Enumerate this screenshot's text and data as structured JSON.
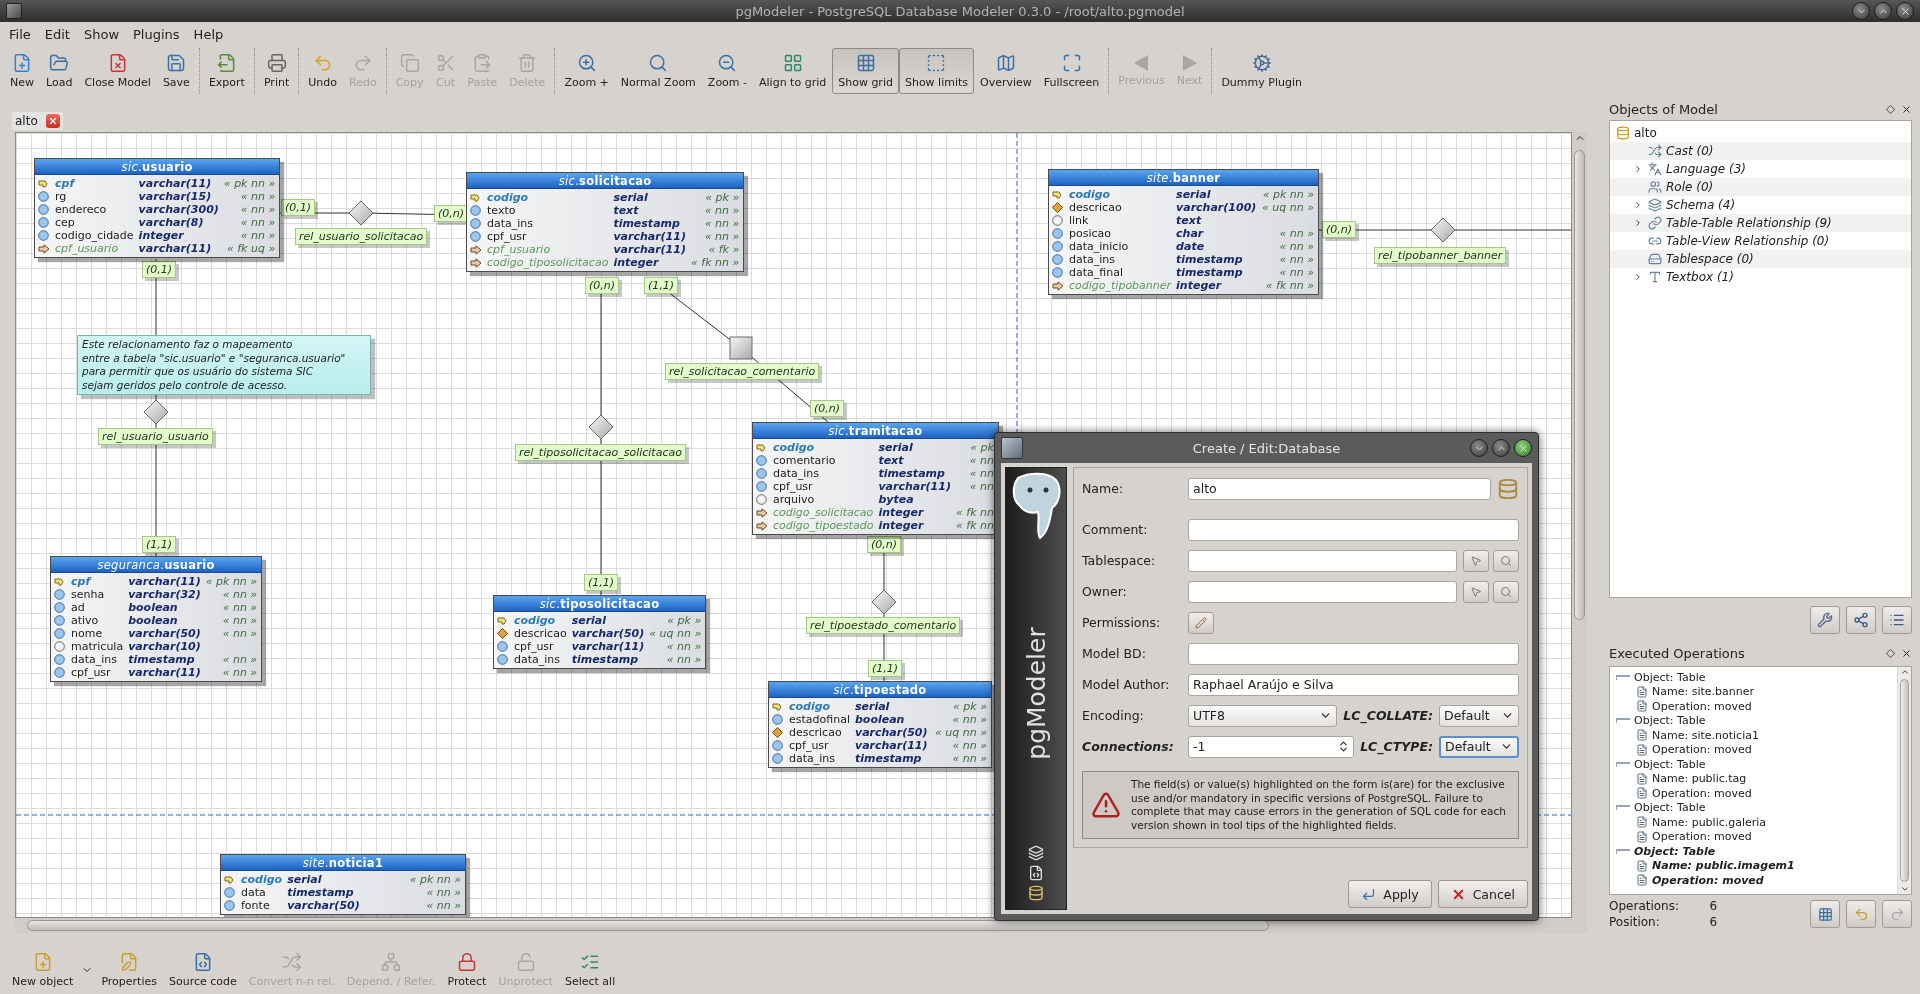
{
  "window": {
    "title": "pgModeler - PostgreSQL Database Modeler 0.3.0 - /root/alto.pgmodel"
  },
  "menu": [
    "File",
    "Edit",
    "Show",
    "Plugins",
    "Help"
  ],
  "toolbar": {
    "groups": [
      {
        "buttons": [
          {
            "label": "New",
            "disabled": false
          },
          {
            "label": "Load",
            "disabled": false
          },
          {
            "label": "Close Model",
            "disabled": false
          },
          {
            "label": "Save",
            "disabled": false
          }
        ]
      },
      {
        "buttons": [
          {
            "label": "Export",
            "disabled": false
          }
        ]
      },
      {
        "buttons": [
          {
            "label": "Print",
            "disabled": false
          }
        ]
      },
      {
        "buttons": [
          {
            "label": "Undo",
            "disabled": false
          },
          {
            "label": "Redo",
            "disabled": true
          }
        ]
      },
      {
        "buttons": [
          {
            "label": "Copy",
            "disabled": true
          },
          {
            "label": "Cut",
            "disabled": true
          },
          {
            "label": "Paste",
            "disabled": true
          },
          {
            "label": "Delete",
            "disabled": true
          }
        ]
      },
      {
        "buttons": [
          {
            "label": "Zoom +",
            "disabled": false
          },
          {
            "label": "Normal Zoom",
            "disabled": false
          },
          {
            "label": "Zoom -",
            "disabled": false
          },
          {
            "label": "Align to grid",
            "disabled": false
          },
          {
            "label": "Show grid",
            "disabled": false,
            "checked": true
          },
          {
            "label": "Show limits",
            "disabled": false,
            "checked": true
          },
          {
            "label": "Overview",
            "disabled": false
          },
          {
            "label": "Fullscreen",
            "disabled": false
          }
        ]
      },
      {
        "buttons": [
          {
            "label": "Previous",
            "disabled": true
          },
          {
            "label": "Next",
            "disabled": true
          }
        ]
      },
      {
        "buttons": [
          {
            "label": "Dummy Plugin",
            "disabled": false
          }
        ]
      }
    ]
  },
  "tabs": [
    {
      "label": "alto",
      "selected": true
    }
  ],
  "diagram": {
    "tables": [
      {
        "title": "*sic*.**usuario**",
        "columns": [
          {
            "name": "cpf",
            "type": "varchar(11)",
            "constraint": "« pk nn »",
            "kind": "pk"
          },
          {
            "name": "rg",
            "type": "varchar(15)",
            "constraint": "« nn »",
            "kind": "nn"
          },
          {
            "name": "endereco",
            "type": "varchar(300)",
            "constraint": "« nn »",
            "kind": "nn"
          },
          {
            "name": "cep",
            "type": "varchar(8)",
            "constraint": "« nn »",
            "kind": "nn"
          },
          {
            "name": "codigo_cidade",
            "type": "integer",
            "constraint": "« nn »",
            "kind": "nn"
          },
          {
            "name": "cpf_usuario",
            "type": "varchar(11)",
            "constraint": "« fk uq »",
            "kind": "fk"
          }
        ]
      },
      {
        "title": "*sic*.**solicitacao**",
        "columns": [
          {
            "name": "codigo",
            "type": "serial",
            "constraint": "« pk »",
            "kind": "pk"
          },
          {
            "name": "texto",
            "type": "text",
            "constraint": "« nn »",
            "kind": "nn"
          },
          {
            "name": "data_ins",
            "type": "timestamp",
            "constraint": "« nn »",
            "kind": "nn"
          },
          {
            "name": "cpf_usr",
            "type": "varchar(11)",
            "constraint": "« nn »",
            "kind": "nn"
          },
          {
            "name": "cpf_usuario",
            "type": "varchar(11)",
            "constraint": "« fk »",
            "kind": "fk"
          },
          {
            "name": "codigo_tiposolicitacao",
            "type": "integer",
            "constraint": "« fk nn »",
            "kind": "fk"
          }
        ]
      },
      {
        "title": "*site*.**banner**",
        "columns": [
          {
            "name": "codigo",
            "type": "serial",
            "constraint": "« pk nn »",
            "kind": "pk"
          },
          {
            "name": "descricao",
            "type": "varchar(100)",
            "constraint": "« uq nn »",
            "kind": "uq"
          },
          {
            "name": "link",
            "type": "text",
            "kind": "plain"
          },
          {
            "name": "posicao",
            "type": "char",
            "constraint": "« nn »",
            "kind": "nn"
          },
          {
            "name": "data_inicio",
            "type": "date",
            "constraint": "« nn »",
            "kind": "nn"
          },
          {
            "name": "data_ins",
            "type": "timestamp",
            "constraint": "« nn »",
            "kind": "nn"
          },
          {
            "name": "data_final",
            "type": "timestamp",
            "constraint": "« nn »",
            "kind": "nn"
          },
          {
            "name": "codigo_tipobanner",
            "type": "integer",
            "constraint": "« fk nn »",
            "kind": "fk"
          }
        ]
      },
      {
        "title": "*sic*.**tramitacao**",
        "columns": [
          {
            "name": "codigo",
            "type": "serial",
            "constraint": "« pk",
            "kind": "pk"
          },
          {
            "name": "comentario",
            "type": "text",
            "constraint": "« nn",
            "kind": "nn"
          },
          {
            "name": "data_ins",
            "type": "timestamp",
            "constraint": "« nn",
            "kind": "nn"
          },
          {
            "name": "cpf_usr",
            "type": "varchar(11)",
            "constraint": "« nn",
            "kind": "nn"
          },
          {
            "name": "arquivo",
            "type": "bytea",
            "kind": "plain"
          },
          {
            "name": "codigo_solicitacao",
            "type": "integer",
            "constraint": "« fk nn",
            "kind": "fk"
          },
          {
            "name": "codigo_tipoestado",
            "type": "integer",
            "constraint": "« fk nn",
            "kind": "fk"
          }
        ]
      },
      {
        "title": "*seguranca*.**usuario**",
        "columns": [
          {
            "name": "cpf",
            "type": "varchar(11)",
            "constraint": "« pk nn »",
            "kind": "pk"
          },
          {
            "name": "senha",
            "type": "varchar(32)",
            "constraint": "« nn »",
            "kind": "nn"
          },
          {
            "name": "ad",
            "type": "boolean",
            "constraint": "« nn »",
            "kind": "nn"
          },
          {
            "name": "ativo",
            "type": "boolean",
            "constraint": "« nn »",
            "kind": "nn"
          },
          {
            "name": "nome",
            "type": "varchar(50)",
            "constraint": "« nn »",
            "kind": "nn"
          },
          {
            "name": "matricula",
            "type": "varchar(10)",
            "kind": "plain"
          },
          {
            "name": "data_ins",
            "type": "timestamp",
            "constraint": "« nn »",
            "kind": "nn"
          },
          {
            "name": "cpf_usr",
            "type": "varchar(11)",
            "constraint": "« nn »",
            "kind": "nn"
          }
        ]
      },
      {
        "title": "*sic*.**tiposolicitacao**",
        "columns": [
          {
            "name": "codigo",
            "type": "serial",
            "constraint": "« pk »",
            "kind": "pk"
          },
          {
            "name": "descricao",
            "type": "varchar(50)",
            "constraint": "« uq nn »",
            "kind": "uq"
          },
          {
            "name": "cpf_usr",
            "type": "varchar(11)",
            "constraint": "« nn »",
            "kind": "nn"
          },
          {
            "name": "data_ins",
            "type": "timestamp",
            "constraint": "« nn »",
            "kind": "nn"
          }
        ]
      },
      {
        "title": "*sic*.**tipoestado**",
        "columns": [
          {
            "name": "codigo",
            "type": "serial",
            "constraint": "« pk »",
            "kind": "pk"
          },
          {
            "name": "estadofinal",
            "type": "boolean",
            "constraint": "« nn »",
            "kind": "nn"
          },
          {
            "name": "descricao",
            "type": "varchar(50)",
            "constraint": "« uq nn »",
            "kind": "uq"
          },
          {
            "name": "cpf_usr",
            "type": "varchar(11)",
            "constraint": "« nn »",
            "kind": "nn"
          },
          {
            "name": "data_ins",
            "type": "timestamp",
            "constraint": "« nn »",
            "kind": "nn"
          }
        ]
      },
      {
        "title": "*site*.**noticia1**",
        "columns": [
          {
            "name": "codigo",
            "type": "serial",
            "constraint": "« pk nn »",
            "kind": "pk"
          },
          {
            "name": "data",
            "type": "timestamp",
            "constraint": "« nn »",
            "kind": "nn"
          },
          {
            "name": "fonte",
            "type": "varchar(50)",
            "constraint": "« nn »",
            "kind": "nn"
          }
        ]
      }
    ],
    "relationships": [
      {
        "label": "rel_usuario_solicitacao",
        "kind": "diamond",
        "cardinalities": [
          "(0,1)",
          "(0,n)"
        ]
      },
      {
        "label": "rel_usuario_usuario",
        "kind": "diamond",
        "cardinalities": [
          "(0,1)",
          "(1,1)"
        ]
      },
      {
        "label": "rel_tiposolicitacao_solicitacao",
        "kind": "diamond",
        "cardinalities": [
          "(0,n)",
          "(1,1)"
        ]
      },
      {
        "label": "rel_solicitacao_comentario",
        "kind": "square",
        "cardinalities": [
          "(1,1)",
          "(0,n)"
        ]
      },
      {
        "label": "rel_tipoestado_comentario",
        "kind": "diamond",
        "cardinalities": [
          "(0,n)",
          "(1,1)"
        ]
      },
      {
        "label": "rel_tipobanner_banner",
        "kind": "diamond",
        "cardinalities": [
          "(0,n)"
        ]
      }
    ],
    "note": "Este relacionamento faz o mapeamento\nentre a tabela \"sic.usuario\" e \"seguranca.usuario\"\npara permitir que os usuário do sistema SIC\nsejam geridos pelo controle de acesso."
  },
  "objects_panel": {
    "title": "Objects of Model",
    "tree": [
      {
        "label": "alto",
        "children": [
          {
            "label": "Cast (0)"
          },
          {
            "label": "Language (3)",
            "expanded": false
          },
          {
            "label": "Role (0)"
          },
          {
            "label": "Schema (4)",
            "expanded": false
          },
          {
            "label": "Table-Table Relationship (9)",
            "expanded": false
          },
          {
            "label": "Table-View Relationship (0)"
          },
          {
            "label": "Tablespace (0)"
          },
          {
            "label": "Textbox (1)",
            "expanded": false
          }
        ]
      }
    ]
  },
  "operations_panel": {
    "title": "Executed Operations",
    "operations": [
      {
        "label": "Object: Table",
        "current": false,
        "children": [
          {
            "label": "Name: site.banner"
          },
          {
            "label": "Operation: moved"
          }
        ]
      },
      {
        "label": "Object: Table",
        "current": false,
        "children": [
          {
            "label": "Name: site.noticia1"
          },
          {
            "label": "Operation: moved"
          }
        ]
      },
      {
        "label": "Object: Table",
        "current": false,
        "children": [
          {
            "label": "Name: public.tag"
          },
          {
            "label": "Operation: moved"
          }
        ]
      },
      {
        "label": "Object: Table",
        "current": false,
        "children": [
          {
            "label": "Name: public.galeria"
          },
          {
            "label": "Operation: moved"
          }
        ]
      },
      {
        "label": "Object: Table",
        "current": true,
        "children": [
          {
            "label": "Name: public.imagem1"
          },
          {
            "label": "Operation: moved"
          }
        ]
      }
    ],
    "stats": [
      {
        "label": "Operations:",
        "value": "6"
      },
      {
        "label": "Position:",
        "value": "6"
      }
    ]
  },
  "bottom_toolbar": [
    {
      "label": "New object",
      "disabled": false,
      "menu": true
    },
    {
      "label": "Properties",
      "disabled": false
    },
    {
      "label": "Source code",
      "disabled": false
    },
    {
      "label": "Convert n-n rel.",
      "disabled": true
    },
    {
      "label": "Depend. / Refer.",
      "disabled": true
    },
    {
      "label": "Protect",
      "disabled": false
    },
    {
      "label": "Unprotect",
      "disabled": true
    },
    {
      "label": "Select all",
      "disabled": false
    }
  ],
  "dialog": {
    "title": "Create / Edit:Database",
    "brand": "pgModeler",
    "rows": [
      {
        "kind": "name",
        "label": "Name:",
        "value": "alto"
      },
      {
        "kind": "text",
        "label": "Comment:"
      },
      {
        "kind": "picker",
        "label": "Tablespace:"
      },
      {
        "kind": "picker",
        "label": "Owner:"
      },
      {
        "kind": "button",
        "label": "Permissions:"
      },
      {
        "kind": "text",
        "label": "Model BD:"
      },
      {
        "kind": "text",
        "label": "Model Author:",
        "value": "Raphael Araújo e Silva"
      },
      {
        "kind": "pair",
        "fields": [
          {
            "label": "Encoding:",
            "kind": "select",
            "value": "UTF8",
            "highlighted": false,
            "focused": false
          },
          {
            "label": "LC_COLLATE:",
            "kind": "select",
            "value": "Default",
            "highlighted": true,
            "focused": false
          }
        ]
      },
      {
        "kind": "pair",
        "fields": [
          {
            "label": "Connections:",
            "kind": "spin",
            "value": "-1",
            "highlighted": true,
            "focused": false
          },
          {
            "label": "LC_CTYPE:",
            "kind": "select",
            "value": "Default",
            "highlighted": true,
            "focused": true
          }
        ]
      }
    ],
    "warning": "The field(s) or value(s) highlighted on the form is(are) for the exclusive use and/or mandatory in specific versions of PostgreSQL. Failure to complete that may cause errors in the generation of SQL code for each version shown in tool tips of the highlighted fields.",
    "buttons": [
      {
        "label": "Apply",
        "kind": "apply"
      },
      {
        "label": "Cancel",
        "kind": "cancel"
      }
    ]
  }
}
